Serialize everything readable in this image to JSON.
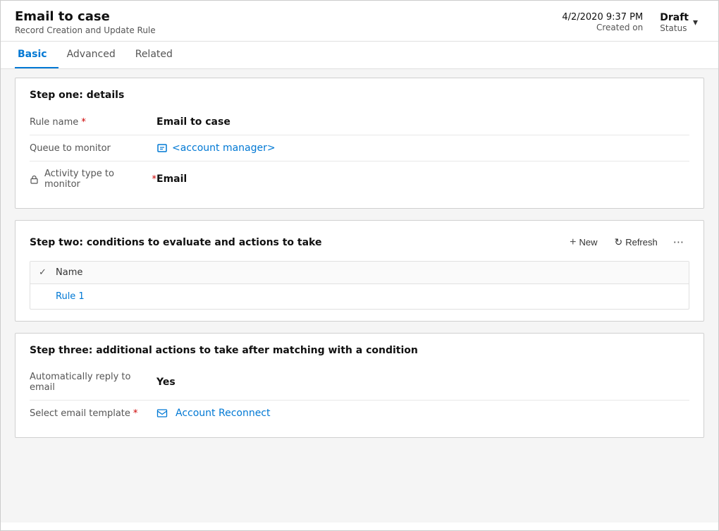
{
  "header": {
    "title": "Email to case",
    "subtitle": "Record Creation and Update Rule",
    "date": "4/2/2020 9:37 PM",
    "created_label": "Created on",
    "status": "Draft",
    "status_label": "Status"
  },
  "tabs": [
    {
      "id": "basic",
      "label": "Basic",
      "active": true
    },
    {
      "id": "advanced",
      "label": "Advanced",
      "active": false
    },
    {
      "id": "related",
      "label": "Related",
      "active": false
    }
  ],
  "step_one": {
    "title": "Step one: details",
    "fields": [
      {
        "label": "Rule name",
        "required": true,
        "value": "Email to case",
        "bold": true,
        "type": "text"
      },
      {
        "label": "Queue to monitor",
        "required": false,
        "value": "<account manager>",
        "type": "link"
      },
      {
        "label": "Activity type to monitor",
        "required": true,
        "value": "Email",
        "bold": true,
        "type": "text",
        "has_lock": true
      }
    ]
  },
  "step_two": {
    "title": "Step two: conditions to evaluate and actions to take",
    "toolbar": {
      "new_label": "New",
      "refresh_label": "Refresh"
    },
    "table": {
      "column_name": "Name",
      "rows": [
        {
          "name": "Rule 1"
        }
      ]
    }
  },
  "step_three": {
    "title": "Step three: additional actions to take after matching with a condition",
    "fields": [
      {
        "label": "Automatically reply to email",
        "required": false,
        "value": "Yes",
        "bold": true,
        "type": "text"
      },
      {
        "label": "Select email template",
        "required": true,
        "value": "Account Reconnect",
        "type": "link"
      }
    ]
  },
  "icons": {
    "chevron_down": "▾",
    "plus": "+",
    "refresh": "↻",
    "ellipsis": "···",
    "checkmark": "✓",
    "lock": "🔒",
    "queue": "📋",
    "email_template": "📧"
  }
}
